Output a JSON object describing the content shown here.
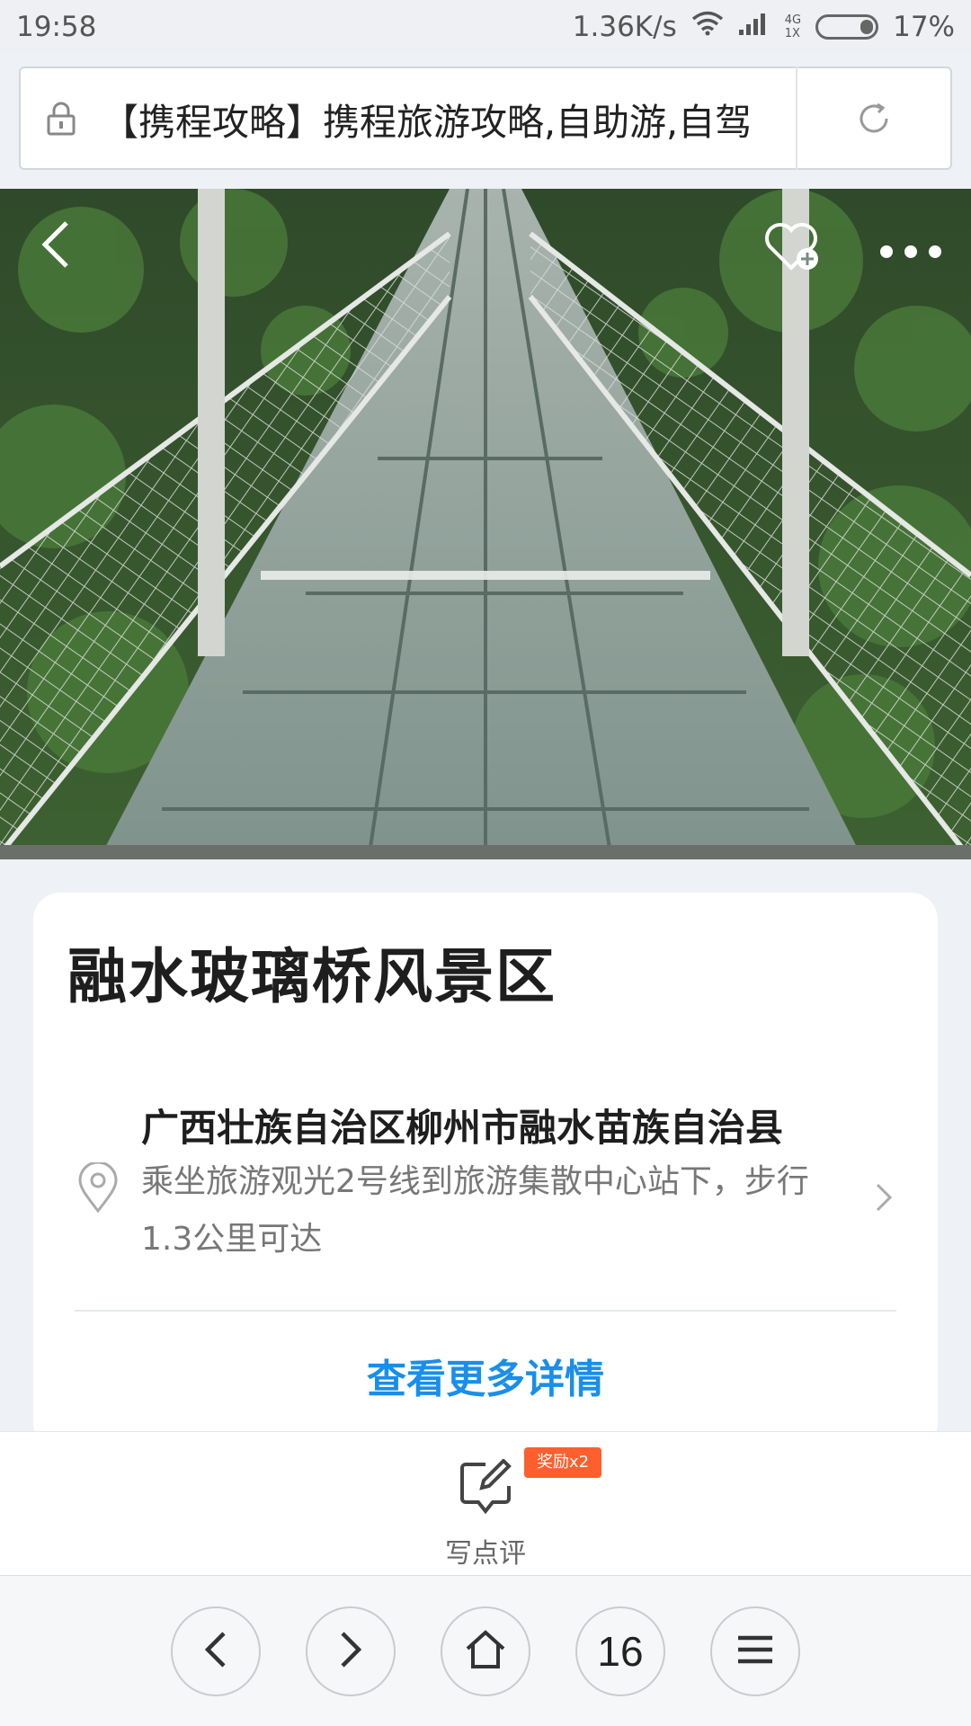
{
  "status_bar": {
    "time": "19:58",
    "speed": "1.36K/s",
    "net_top": "4G",
    "net_bottom": "1X",
    "battery": "17%"
  },
  "url_bar": {
    "text": "【携程攻略】携程旅游攻略,自助游,自驾"
  },
  "hero": {
    "icons": [
      "back-arrow-icon",
      "favorite-add-icon",
      "more-options-icon"
    ]
  },
  "card": {
    "title": "融水玻璃桥风景区",
    "address": "广西壮族自治区柳州市融水苗族自治县",
    "directions": "乘坐旅游观光2号线到旅游集散中心站下，步行1.3公里可达",
    "more_link": "查看更多详情"
  },
  "review": {
    "label": "写点评",
    "badge": "奖励x2"
  },
  "browser_nav": {
    "tabs_count": "16"
  },
  "colors": {
    "accent": "#1a8ee8",
    "badge": "#ff5e2e",
    "background": "#eef1f5"
  }
}
